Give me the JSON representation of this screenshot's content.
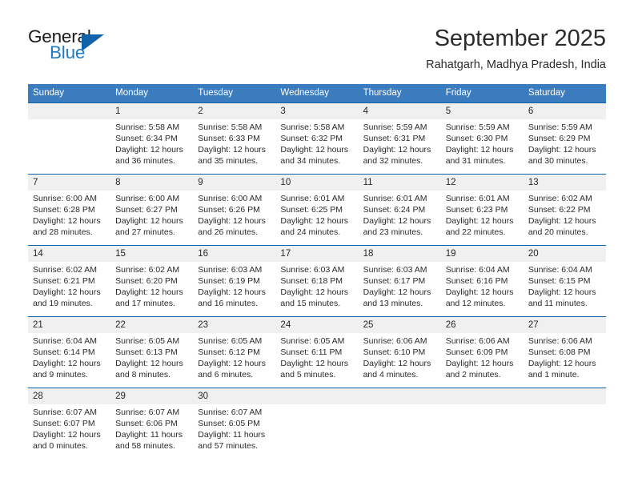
{
  "logo": {
    "text_top": "General",
    "text_bottom": "Blue",
    "triangle_icon": "triangle-icon",
    "accent_color": "#1e7bc4",
    "dark_color": "#1063a8"
  },
  "header": {
    "month_title": "September 2025",
    "location": "Rahatgarh, Madhya Pradesh, India"
  },
  "theme": {
    "header_row_bg": "#3b7cbf",
    "row_divider": "#1063a8",
    "day_number_bg": "#f0f0f0",
    "text": "#2a2a2a"
  },
  "weekdays": [
    "Sunday",
    "Monday",
    "Tuesday",
    "Wednesday",
    "Thursday",
    "Friday",
    "Saturday"
  ],
  "weeks": [
    [
      {
        "day": "",
        "empty": true,
        "sunrise": "",
        "sunset": "",
        "daylight1": "",
        "daylight2": ""
      },
      {
        "day": "1",
        "sunrise": "Sunrise: 5:58 AM",
        "sunset": "Sunset: 6:34 PM",
        "daylight1": "Daylight: 12 hours",
        "daylight2": "and 36 minutes."
      },
      {
        "day": "2",
        "sunrise": "Sunrise: 5:58 AM",
        "sunset": "Sunset: 6:33 PM",
        "daylight1": "Daylight: 12 hours",
        "daylight2": "and 35 minutes."
      },
      {
        "day": "3",
        "sunrise": "Sunrise: 5:58 AM",
        "sunset": "Sunset: 6:32 PM",
        "daylight1": "Daylight: 12 hours",
        "daylight2": "and 34 minutes."
      },
      {
        "day": "4",
        "sunrise": "Sunrise: 5:59 AM",
        "sunset": "Sunset: 6:31 PM",
        "daylight1": "Daylight: 12 hours",
        "daylight2": "and 32 minutes."
      },
      {
        "day": "5",
        "sunrise": "Sunrise: 5:59 AM",
        "sunset": "Sunset: 6:30 PM",
        "daylight1": "Daylight: 12 hours",
        "daylight2": "and 31 minutes."
      },
      {
        "day": "6",
        "sunrise": "Sunrise: 5:59 AM",
        "sunset": "Sunset: 6:29 PM",
        "daylight1": "Daylight: 12 hours",
        "daylight2": "and 30 minutes."
      }
    ],
    [
      {
        "day": "7",
        "sunrise": "Sunrise: 6:00 AM",
        "sunset": "Sunset: 6:28 PM",
        "daylight1": "Daylight: 12 hours",
        "daylight2": "and 28 minutes."
      },
      {
        "day": "8",
        "sunrise": "Sunrise: 6:00 AM",
        "sunset": "Sunset: 6:27 PM",
        "daylight1": "Daylight: 12 hours",
        "daylight2": "and 27 minutes."
      },
      {
        "day": "9",
        "sunrise": "Sunrise: 6:00 AM",
        "sunset": "Sunset: 6:26 PM",
        "daylight1": "Daylight: 12 hours",
        "daylight2": "and 26 minutes."
      },
      {
        "day": "10",
        "sunrise": "Sunrise: 6:01 AM",
        "sunset": "Sunset: 6:25 PM",
        "daylight1": "Daylight: 12 hours",
        "daylight2": "and 24 minutes."
      },
      {
        "day": "11",
        "sunrise": "Sunrise: 6:01 AM",
        "sunset": "Sunset: 6:24 PM",
        "daylight1": "Daylight: 12 hours",
        "daylight2": "and 23 minutes."
      },
      {
        "day": "12",
        "sunrise": "Sunrise: 6:01 AM",
        "sunset": "Sunset: 6:23 PM",
        "daylight1": "Daylight: 12 hours",
        "daylight2": "and 22 minutes."
      },
      {
        "day": "13",
        "sunrise": "Sunrise: 6:02 AM",
        "sunset": "Sunset: 6:22 PM",
        "daylight1": "Daylight: 12 hours",
        "daylight2": "and 20 minutes."
      }
    ],
    [
      {
        "day": "14",
        "sunrise": "Sunrise: 6:02 AM",
        "sunset": "Sunset: 6:21 PM",
        "daylight1": "Daylight: 12 hours",
        "daylight2": "and 19 minutes."
      },
      {
        "day": "15",
        "sunrise": "Sunrise: 6:02 AM",
        "sunset": "Sunset: 6:20 PM",
        "daylight1": "Daylight: 12 hours",
        "daylight2": "and 17 minutes."
      },
      {
        "day": "16",
        "sunrise": "Sunrise: 6:03 AM",
        "sunset": "Sunset: 6:19 PM",
        "daylight1": "Daylight: 12 hours",
        "daylight2": "and 16 minutes."
      },
      {
        "day": "17",
        "sunrise": "Sunrise: 6:03 AM",
        "sunset": "Sunset: 6:18 PM",
        "daylight1": "Daylight: 12 hours",
        "daylight2": "and 15 minutes."
      },
      {
        "day": "18",
        "sunrise": "Sunrise: 6:03 AM",
        "sunset": "Sunset: 6:17 PM",
        "daylight1": "Daylight: 12 hours",
        "daylight2": "and 13 minutes."
      },
      {
        "day": "19",
        "sunrise": "Sunrise: 6:04 AM",
        "sunset": "Sunset: 6:16 PM",
        "daylight1": "Daylight: 12 hours",
        "daylight2": "and 12 minutes."
      },
      {
        "day": "20",
        "sunrise": "Sunrise: 6:04 AM",
        "sunset": "Sunset: 6:15 PM",
        "daylight1": "Daylight: 12 hours",
        "daylight2": "and 11 minutes."
      }
    ],
    [
      {
        "day": "21",
        "sunrise": "Sunrise: 6:04 AM",
        "sunset": "Sunset: 6:14 PM",
        "daylight1": "Daylight: 12 hours",
        "daylight2": "and 9 minutes."
      },
      {
        "day": "22",
        "sunrise": "Sunrise: 6:05 AM",
        "sunset": "Sunset: 6:13 PM",
        "daylight1": "Daylight: 12 hours",
        "daylight2": "and 8 minutes."
      },
      {
        "day": "23",
        "sunrise": "Sunrise: 6:05 AM",
        "sunset": "Sunset: 6:12 PM",
        "daylight1": "Daylight: 12 hours",
        "daylight2": "and 6 minutes."
      },
      {
        "day": "24",
        "sunrise": "Sunrise: 6:05 AM",
        "sunset": "Sunset: 6:11 PM",
        "daylight1": "Daylight: 12 hours",
        "daylight2": "and 5 minutes."
      },
      {
        "day": "25",
        "sunrise": "Sunrise: 6:06 AM",
        "sunset": "Sunset: 6:10 PM",
        "daylight1": "Daylight: 12 hours",
        "daylight2": "and 4 minutes."
      },
      {
        "day": "26",
        "sunrise": "Sunrise: 6:06 AM",
        "sunset": "Sunset: 6:09 PM",
        "daylight1": "Daylight: 12 hours",
        "daylight2": "and 2 minutes."
      },
      {
        "day": "27",
        "sunrise": "Sunrise: 6:06 AM",
        "sunset": "Sunset: 6:08 PM",
        "daylight1": "Daylight: 12 hours",
        "daylight2": "and 1 minute."
      }
    ],
    [
      {
        "day": "28",
        "sunrise": "Sunrise: 6:07 AM",
        "sunset": "Sunset: 6:07 PM",
        "daylight1": "Daylight: 12 hours",
        "daylight2": "and 0 minutes."
      },
      {
        "day": "29",
        "sunrise": "Sunrise: 6:07 AM",
        "sunset": "Sunset: 6:06 PM",
        "daylight1": "Daylight: 11 hours",
        "daylight2": "and 58 minutes."
      },
      {
        "day": "30",
        "sunrise": "Sunrise: 6:07 AM",
        "sunset": "Sunset: 6:05 PM",
        "daylight1": "Daylight: 11 hours",
        "daylight2": "and 57 minutes."
      },
      {
        "day": "",
        "empty": true,
        "sunrise": "",
        "sunset": "",
        "daylight1": "",
        "daylight2": ""
      },
      {
        "day": "",
        "empty": true,
        "sunrise": "",
        "sunset": "",
        "daylight1": "",
        "daylight2": ""
      },
      {
        "day": "",
        "empty": true,
        "sunrise": "",
        "sunset": "",
        "daylight1": "",
        "daylight2": ""
      },
      {
        "day": "",
        "empty": true,
        "sunrise": "",
        "sunset": "",
        "daylight1": "",
        "daylight2": ""
      }
    ]
  ]
}
